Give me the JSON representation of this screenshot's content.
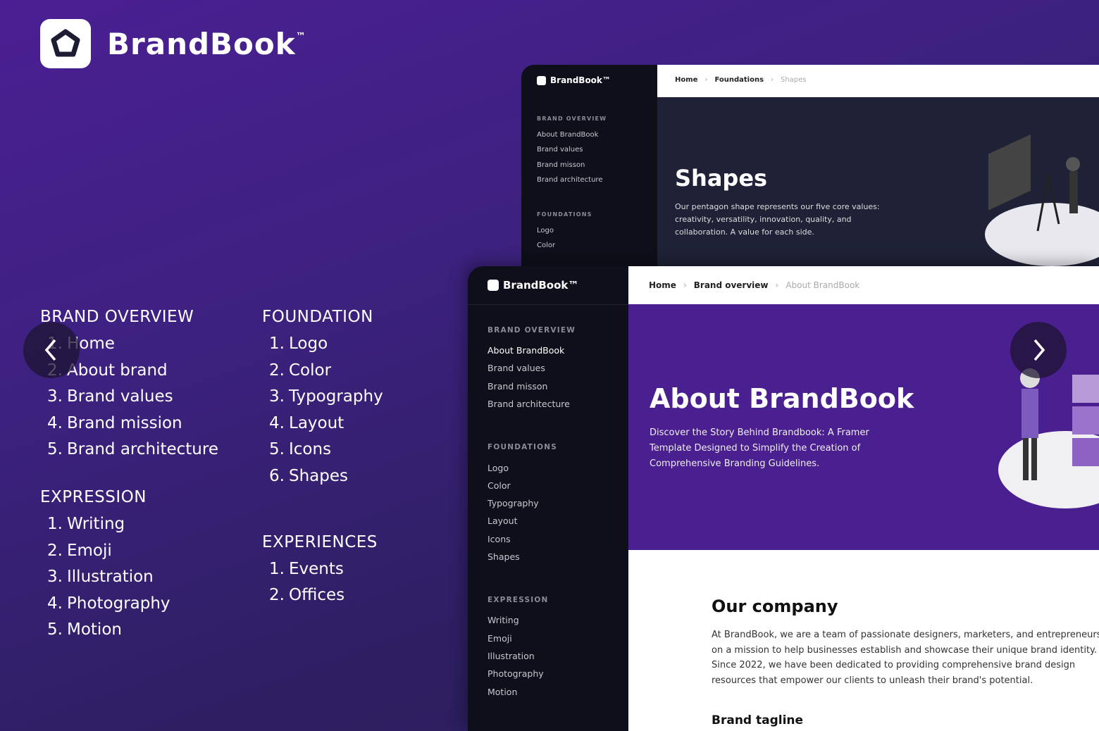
{
  "brand": {
    "name": "BrandBook",
    "tm": "™",
    "logo_icon": "pentagon-icon"
  },
  "nav": {
    "columns": [
      [
        {
          "title": "BRAND OVERVIEW",
          "items": [
            "Home",
            "About brand",
            "Brand values",
            "Brand mission",
            "Brand architecture"
          ]
        },
        {
          "title": "EXPRESSION",
          "items": [
            "Writing",
            "Emoji",
            "Illustration",
            "Photography",
            "Motion"
          ]
        }
      ],
      [
        {
          "title": "FOUNDATION",
          "items": [
            "Logo",
            "Color",
            "Typography",
            "Layout",
            "Icons",
            "Shapes"
          ]
        },
        {
          "title": "EXPERIENCES",
          "items": [
            "Events",
            "Offices"
          ]
        }
      ]
    ]
  },
  "carousel": {
    "prev_icon": "chevron-left-icon",
    "next_icon": "chevron-right-icon"
  },
  "mock_back": {
    "logo": "BrandBook™",
    "breadcrumb": [
      "Home",
      "Foundations",
      "Shapes"
    ],
    "sidebar": [
      {
        "title": "BRAND OVERVIEW",
        "items": [
          "About BrandBook",
          "Brand values",
          "Brand misson",
          "Brand architecture"
        ]
      },
      {
        "title": "FOUNDATIONS",
        "items": [
          "Logo",
          "Color"
        ]
      }
    ],
    "hero_title": "Shapes",
    "hero_text": "Our pentagon shape represents our five core values: creativity, versatility, innovation, quality, and collaboration. A value for each side.",
    "colors": {
      "hero_bg": "#1f2236"
    }
  },
  "mock_front": {
    "logo": "BrandBook™",
    "breadcrumb": [
      "Home",
      "Brand overview",
      "About BrandBook"
    ],
    "sidebar": [
      {
        "title": "BRAND OVERVIEW",
        "items": [
          "About BrandBook",
          "Brand values",
          "Brand misson",
          "Brand architecture"
        ]
      },
      {
        "title": "FOUNDATIONS",
        "items": [
          "Logo",
          "Color",
          "Typography",
          "Layout",
          "Icons",
          "Shapes"
        ]
      },
      {
        "title": "EXPRESSION",
        "items": [
          "Writing",
          "Emoji",
          "Illustration",
          "Photography",
          "Motion"
        ]
      }
    ],
    "hero_title": "About BrandBook",
    "hero_text": "Discover the Story Behind Brandbook: A Framer Template Designed to Simplify the Creation of Comprehensive Branding Guidelines.",
    "section_title": "Our company",
    "section_text": "At BrandBook, we are a team of passionate designers, marketers, and entrepreneurs on a mission to help businesses establish and showcase their unique brand identity. Since 2022, we have been dedicated to providing comprehensive brand design resources that empower our clients to unleash their brand's potential.",
    "next_heading": "Brand tagline",
    "colors": {
      "hero_bg": "#4a1f8f"
    }
  }
}
